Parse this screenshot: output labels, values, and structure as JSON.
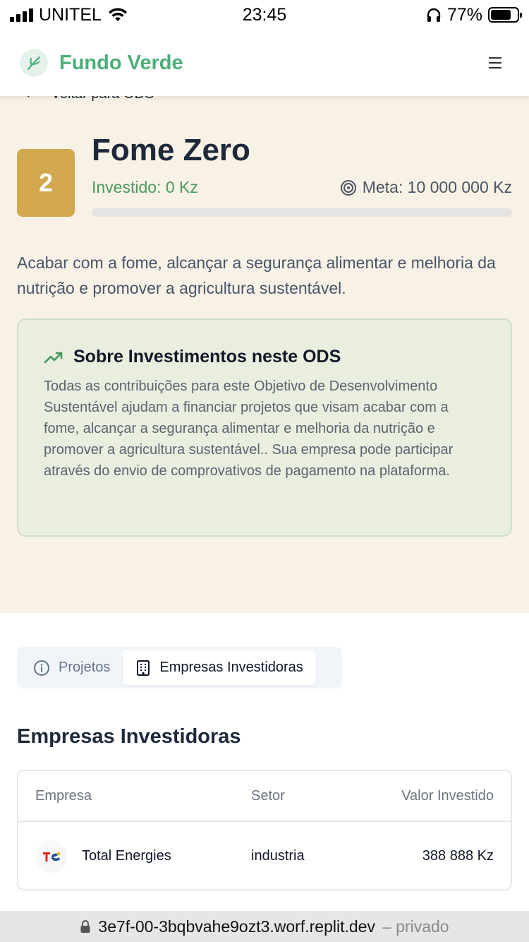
{
  "status_bar": {
    "carrier": "UNITEL",
    "time": "23:45",
    "battery_percent": "77%",
    "battery_level": 0.77
  },
  "header": {
    "brand_name": "Fundo Verde",
    "brand_color": "#4caf7a"
  },
  "hero": {
    "back_label": "Voltar para ODS",
    "ods_number": "2",
    "badge_color": "#d1a84e",
    "title": "Fome Zero",
    "invested_label": "Investido: 0 Kz",
    "goal_label": "Meta: 10 000 000 Kz",
    "progress_fraction": 0,
    "description": "Acabar com a fome, alcançar a segurança alimentar e melhoria da nutrição e promover a agricultura sustentável.",
    "info_card": {
      "title": "Sobre Investimentos neste ODS",
      "body": "Todas as contribuições para este Objetivo de Desenvolvimento Sustentável ajudam a financiar projetos que visam acabar com a fome, alcançar a segurança alimentar e melhoria da nutrição e promover a agricultura sustentável.. Sua empresa pode participar através do envio de comprovativos de pagamento na plataforma."
    }
  },
  "tabs": [
    {
      "label": "Projetos",
      "icon": "info-icon",
      "active": false
    },
    {
      "label": "Empresas Investidoras",
      "icon": "building-icon",
      "active": true
    }
  ],
  "companies": {
    "section_title": "Empresas Investidoras",
    "columns": [
      "Empresa",
      "Setor",
      "Valor Investido"
    ],
    "rows": [
      {
        "company": "Total Energies",
        "sector": "industria",
        "amount": "388 888 Kz",
        "logo_text": "TotalEnergies"
      }
    ]
  },
  "url_bar": {
    "url": "3e7f-00-3bqbvahe9ozt3.worf.replit.dev",
    "suffix": "– privado"
  }
}
